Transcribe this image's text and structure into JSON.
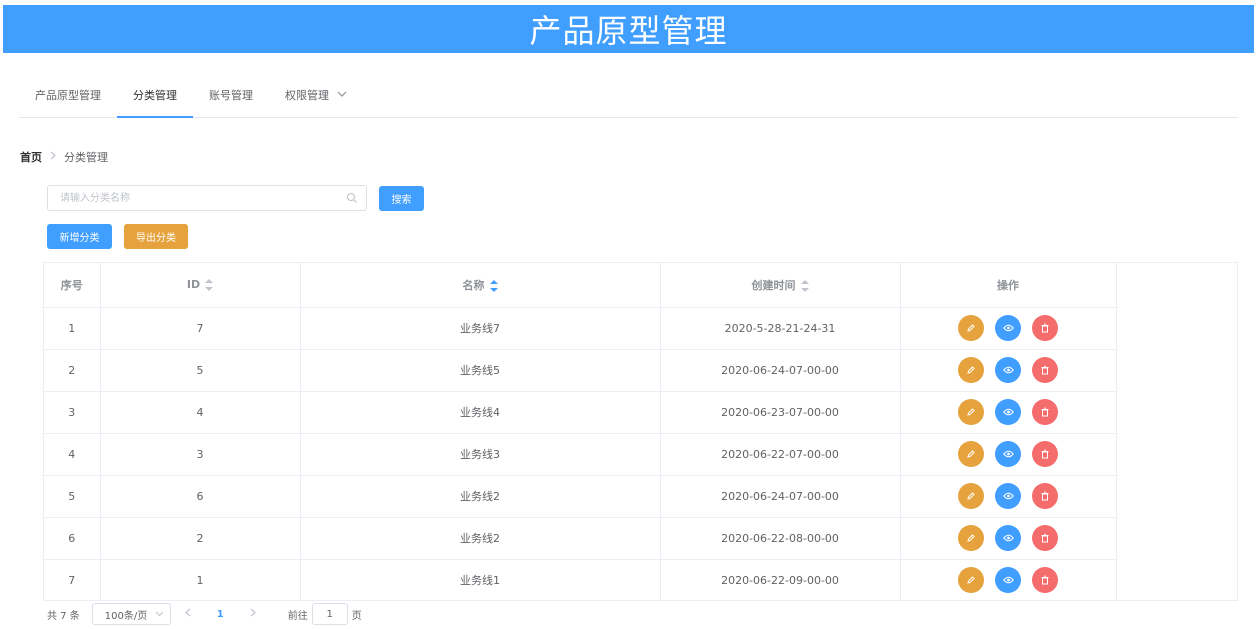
{
  "app_title": "产品原型管理",
  "tabs": [
    {
      "label": "产品原型管理"
    },
    {
      "label": "分类管理"
    },
    {
      "label": "账号管理"
    },
    {
      "label": "权限管理"
    }
  ],
  "active_tab": "分类管理",
  "breadcrumb": {
    "home": "首页",
    "current": "分类管理"
  },
  "search": {
    "placeholder": "请输入分类名称",
    "value": "",
    "button_label": "搜索"
  },
  "actions": {
    "add_label": "新增分类",
    "export_label": "导出分类"
  },
  "table": {
    "columns": {
      "index": "序号",
      "id": "ID",
      "name": "名称",
      "created": "创建时间",
      "ops": "操作"
    },
    "rows": [
      {
        "index": "1",
        "id": "7",
        "name": "业务线7",
        "created": "2020-5-28-21-24-31"
      },
      {
        "index": "2",
        "id": "5",
        "name": "业务线5",
        "created": "2020-06-24-07-00-00"
      },
      {
        "index": "3",
        "id": "4",
        "name": "业务线4",
        "created": "2020-06-23-07-00-00"
      },
      {
        "index": "4",
        "id": "3",
        "name": "业务线3",
        "created": "2020-06-22-07-00-00"
      },
      {
        "index": "5",
        "id": "6",
        "name": "业务线2",
        "created": "2020-06-24-07-00-00"
      },
      {
        "index": "6",
        "id": "2",
        "name": "业务线2",
        "created": "2020-06-22-08-00-00"
      },
      {
        "index": "7",
        "id": "1",
        "name": "业务线1",
        "created": "2020-06-22-09-00-00"
      }
    ]
  },
  "pagination": {
    "total_text": "共 7 条",
    "page_size": "100条/页",
    "current_page": "1",
    "goto_label": "前往",
    "goto_value": "1",
    "page_unit": "页"
  },
  "colors": {
    "primary": "#409eff",
    "warning": "#e6a23c",
    "danger": "#f56c6c"
  },
  "icons": {
    "edit": "pencil-icon",
    "view": "eye-icon",
    "delete": "trash-icon",
    "search": "search-icon"
  }
}
